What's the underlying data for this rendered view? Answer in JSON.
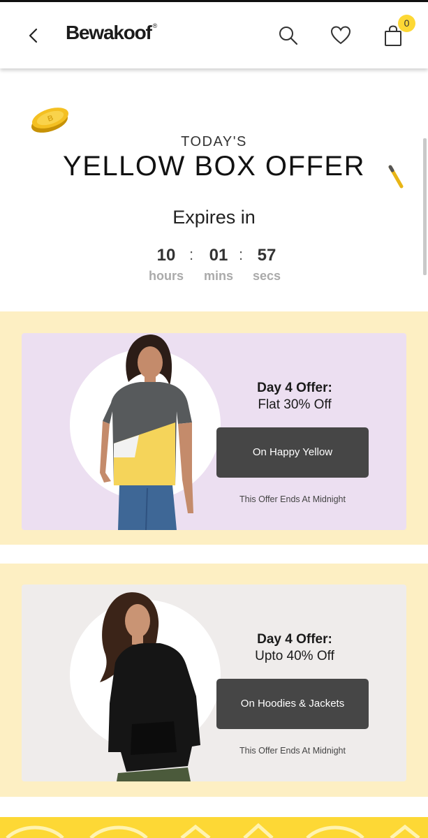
{
  "header": {
    "brand": "Bewakoof",
    "brand_mark": "®",
    "cart_count": "0",
    "icons": [
      "back-arrow-icon",
      "search-icon",
      "heart-icon",
      "bag-icon"
    ]
  },
  "hero": {
    "today": "TODAY'S",
    "title": "YELLOW BOX OFFER",
    "expires": "Expires in",
    "countdown": {
      "hours": "10",
      "mins": "01",
      "secs": "57",
      "hours_label": "hours",
      "mins_label": "mins",
      "secs_label": "secs",
      "separator": ":"
    }
  },
  "offers": [
    {
      "title": "Day 4 Offer:",
      "subtitle": "Flat 30% Off",
      "cta": "On Happy Yellow",
      "note": "This Offer Ends At Midnight",
      "card_color": "#ecdff1"
    },
    {
      "title": "Day 4 Offer:",
      "subtitle": "Upto 40% Off",
      "cta": "On Hoodies & Jackets",
      "note": "This Offer Ends At Midnight",
      "card_color": "#efeceb"
    }
  ],
  "colors": {
    "accent_yellow": "#fdd835",
    "band_yellow": "#fdefc3",
    "cta_dark": "#464646"
  }
}
